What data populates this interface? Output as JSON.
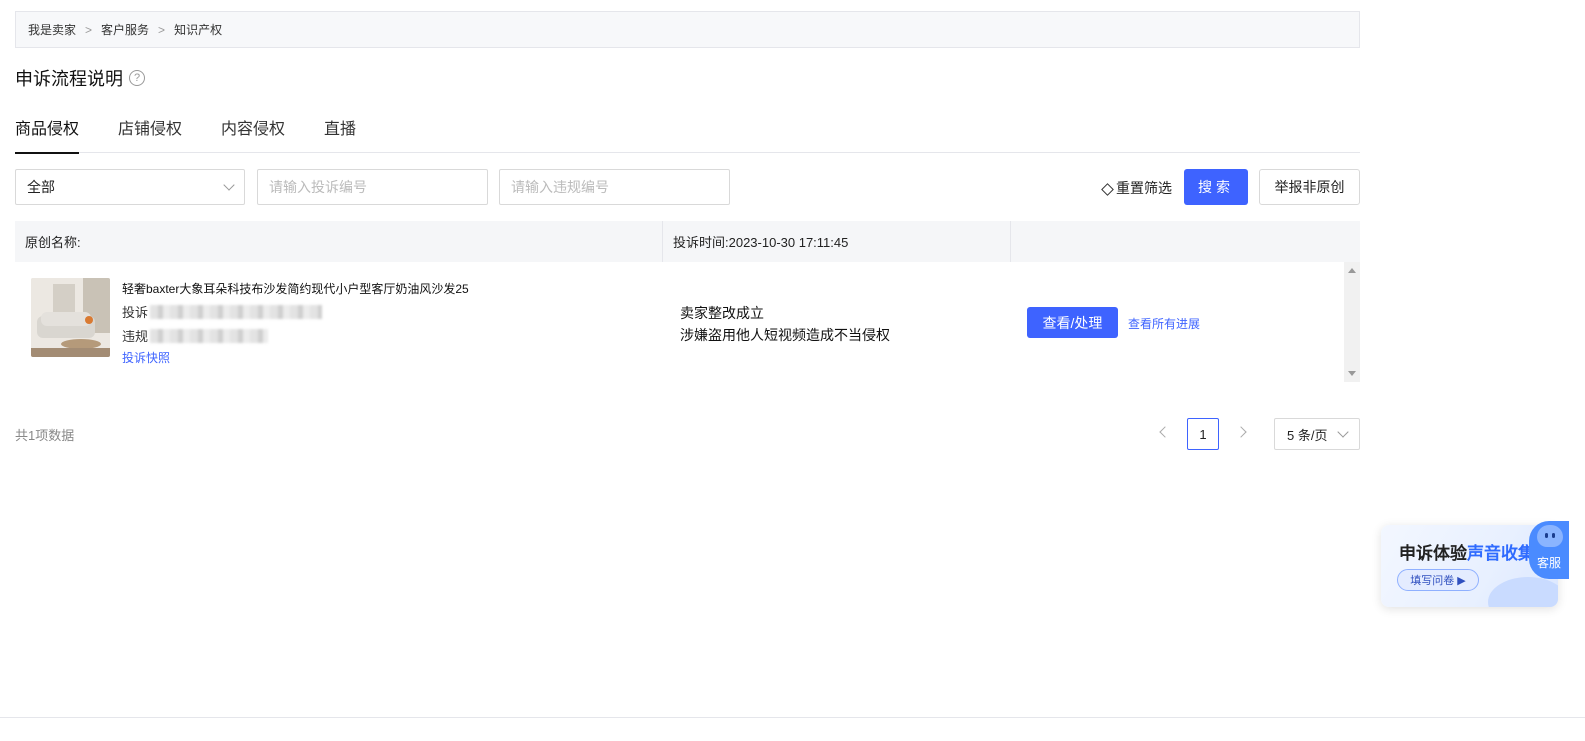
{
  "breadcrumb": {
    "items": [
      "我是卖家",
      "客户服务",
      "知识产权"
    ],
    "separator": ">"
  },
  "page": {
    "title": "申诉流程说明",
    "help_icon": "?"
  },
  "tabs": [
    {
      "label": "商品侵权",
      "active": true
    },
    {
      "label": "店铺侵权",
      "active": false
    },
    {
      "label": "内容侵权",
      "active": false
    },
    {
      "label": "直播",
      "active": false
    }
  ],
  "filters": {
    "status_select": "全部",
    "complaint_no_placeholder": "请输入投诉编号",
    "violation_no_placeholder": "请输入违规编号",
    "reset_label": "重置筛选",
    "search_label": "搜索",
    "report_label": "举报非原创"
  },
  "table": {
    "headers": {
      "original_name": "原创名称:",
      "complaint_time": "投诉时间:2023-10-30 17:11:45"
    },
    "rows": [
      {
        "product_title": "轻奢baxter大象耳朵科技布沙发简约现代小户型客厅奶油风沙发25",
        "complaint_prefix": "投诉",
        "violation_prefix": "违规",
        "snapshot_link": "投诉快照",
        "status": "卖家整改成立",
        "reason": "涉嫌盗用他人短视频造成不当侵权",
        "action_label": "查看/处理",
        "progress_link": "查看所有进展"
      }
    ]
  },
  "pagination": {
    "total": "共1项数据",
    "current_page": "1",
    "page_size": "5 条/页"
  },
  "widgets": {
    "survey_title_plain": "申诉体验",
    "survey_title_highlight": "声音收集",
    "survey_button": "填写问卷 ▶",
    "service_label": "客服"
  },
  "colors": {
    "primary": "#3e63ff",
    "highlight": "#2f6bff"
  }
}
